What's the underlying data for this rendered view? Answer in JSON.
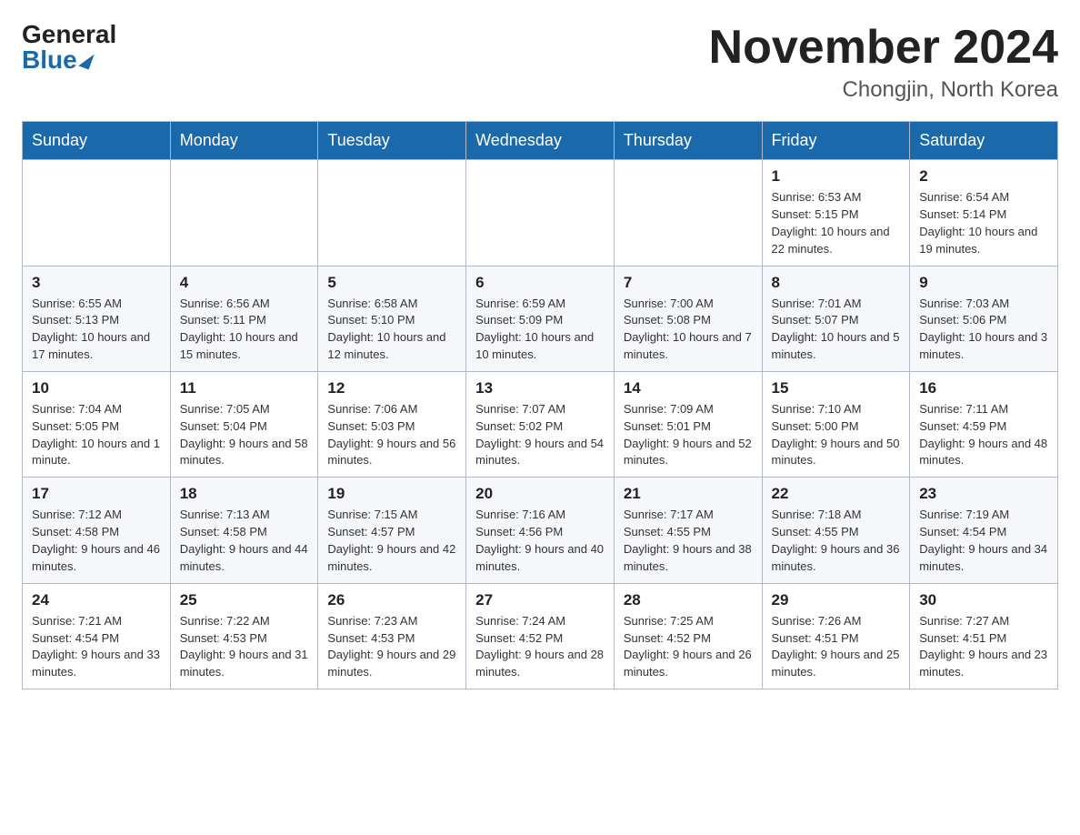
{
  "logo": {
    "general": "General",
    "blue": "Blue"
  },
  "header": {
    "month_year": "November 2024",
    "location": "Chongjin, North Korea"
  },
  "weekdays": [
    "Sunday",
    "Monday",
    "Tuesday",
    "Wednesday",
    "Thursday",
    "Friday",
    "Saturday"
  ],
  "weeks": [
    [
      {
        "day": "",
        "info": ""
      },
      {
        "day": "",
        "info": ""
      },
      {
        "day": "",
        "info": ""
      },
      {
        "day": "",
        "info": ""
      },
      {
        "day": "",
        "info": ""
      },
      {
        "day": "1",
        "info": "Sunrise: 6:53 AM\nSunset: 5:15 PM\nDaylight: 10 hours and 22 minutes."
      },
      {
        "day": "2",
        "info": "Sunrise: 6:54 AM\nSunset: 5:14 PM\nDaylight: 10 hours and 19 minutes."
      }
    ],
    [
      {
        "day": "3",
        "info": "Sunrise: 6:55 AM\nSunset: 5:13 PM\nDaylight: 10 hours and 17 minutes."
      },
      {
        "day": "4",
        "info": "Sunrise: 6:56 AM\nSunset: 5:11 PM\nDaylight: 10 hours and 15 minutes."
      },
      {
        "day": "5",
        "info": "Sunrise: 6:58 AM\nSunset: 5:10 PM\nDaylight: 10 hours and 12 minutes."
      },
      {
        "day": "6",
        "info": "Sunrise: 6:59 AM\nSunset: 5:09 PM\nDaylight: 10 hours and 10 minutes."
      },
      {
        "day": "7",
        "info": "Sunrise: 7:00 AM\nSunset: 5:08 PM\nDaylight: 10 hours and 7 minutes."
      },
      {
        "day": "8",
        "info": "Sunrise: 7:01 AM\nSunset: 5:07 PM\nDaylight: 10 hours and 5 minutes."
      },
      {
        "day": "9",
        "info": "Sunrise: 7:03 AM\nSunset: 5:06 PM\nDaylight: 10 hours and 3 minutes."
      }
    ],
    [
      {
        "day": "10",
        "info": "Sunrise: 7:04 AM\nSunset: 5:05 PM\nDaylight: 10 hours and 1 minute."
      },
      {
        "day": "11",
        "info": "Sunrise: 7:05 AM\nSunset: 5:04 PM\nDaylight: 9 hours and 58 minutes."
      },
      {
        "day": "12",
        "info": "Sunrise: 7:06 AM\nSunset: 5:03 PM\nDaylight: 9 hours and 56 minutes."
      },
      {
        "day": "13",
        "info": "Sunrise: 7:07 AM\nSunset: 5:02 PM\nDaylight: 9 hours and 54 minutes."
      },
      {
        "day": "14",
        "info": "Sunrise: 7:09 AM\nSunset: 5:01 PM\nDaylight: 9 hours and 52 minutes."
      },
      {
        "day": "15",
        "info": "Sunrise: 7:10 AM\nSunset: 5:00 PM\nDaylight: 9 hours and 50 minutes."
      },
      {
        "day": "16",
        "info": "Sunrise: 7:11 AM\nSunset: 4:59 PM\nDaylight: 9 hours and 48 minutes."
      }
    ],
    [
      {
        "day": "17",
        "info": "Sunrise: 7:12 AM\nSunset: 4:58 PM\nDaylight: 9 hours and 46 minutes."
      },
      {
        "day": "18",
        "info": "Sunrise: 7:13 AM\nSunset: 4:58 PM\nDaylight: 9 hours and 44 minutes."
      },
      {
        "day": "19",
        "info": "Sunrise: 7:15 AM\nSunset: 4:57 PM\nDaylight: 9 hours and 42 minutes."
      },
      {
        "day": "20",
        "info": "Sunrise: 7:16 AM\nSunset: 4:56 PM\nDaylight: 9 hours and 40 minutes."
      },
      {
        "day": "21",
        "info": "Sunrise: 7:17 AM\nSunset: 4:55 PM\nDaylight: 9 hours and 38 minutes."
      },
      {
        "day": "22",
        "info": "Sunrise: 7:18 AM\nSunset: 4:55 PM\nDaylight: 9 hours and 36 minutes."
      },
      {
        "day": "23",
        "info": "Sunrise: 7:19 AM\nSunset: 4:54 PM\nDaylight: 9 hours and 34 minutes."
      }
    ],
    [
      {
        "day": "24",
        "info": "Sunrise: 7:21 AM\nSunset: 4:54 PM\nDaylight: 9 hours and 33 minutes."
      },
      {
        "day": "25",
        "info": "Sunrise: 7:22 AM\nSunset: 4:53 PM\nDaylight: 9 hours and 31 minutes."
      },
      {
        "day": "26",
        "info": "Sunrise: 7:23 AM\nSunset: 4:53 PM\nDaylight: 9 hours and 29 minutes."
      },
      {
        "day": "27",
        "info": "Sunrise: 7:24 AM\nSunset: 4:52 PM\nDaylight: 9 hours and 28 minutes."
      },
      {
        "day": "28",
        "info": "Sunrise: 7:25 AM\nSunset: 4:52 PM\nDaylight: 9 hours and 26 minutes."
      },
      {
        "day": "29",
        "info": "Sunrise: 7:26 AM\nSunset: 4:51 PM\nDaylight: 9 hours and 25 minutes."
      },
      {
        "day": "30",
        "info": "Sunrise: 7:27 AM\nSunset: 4:51 PM\nDaylight: 9 hours and 23 minutes."
      }
    ]
  ]
}
